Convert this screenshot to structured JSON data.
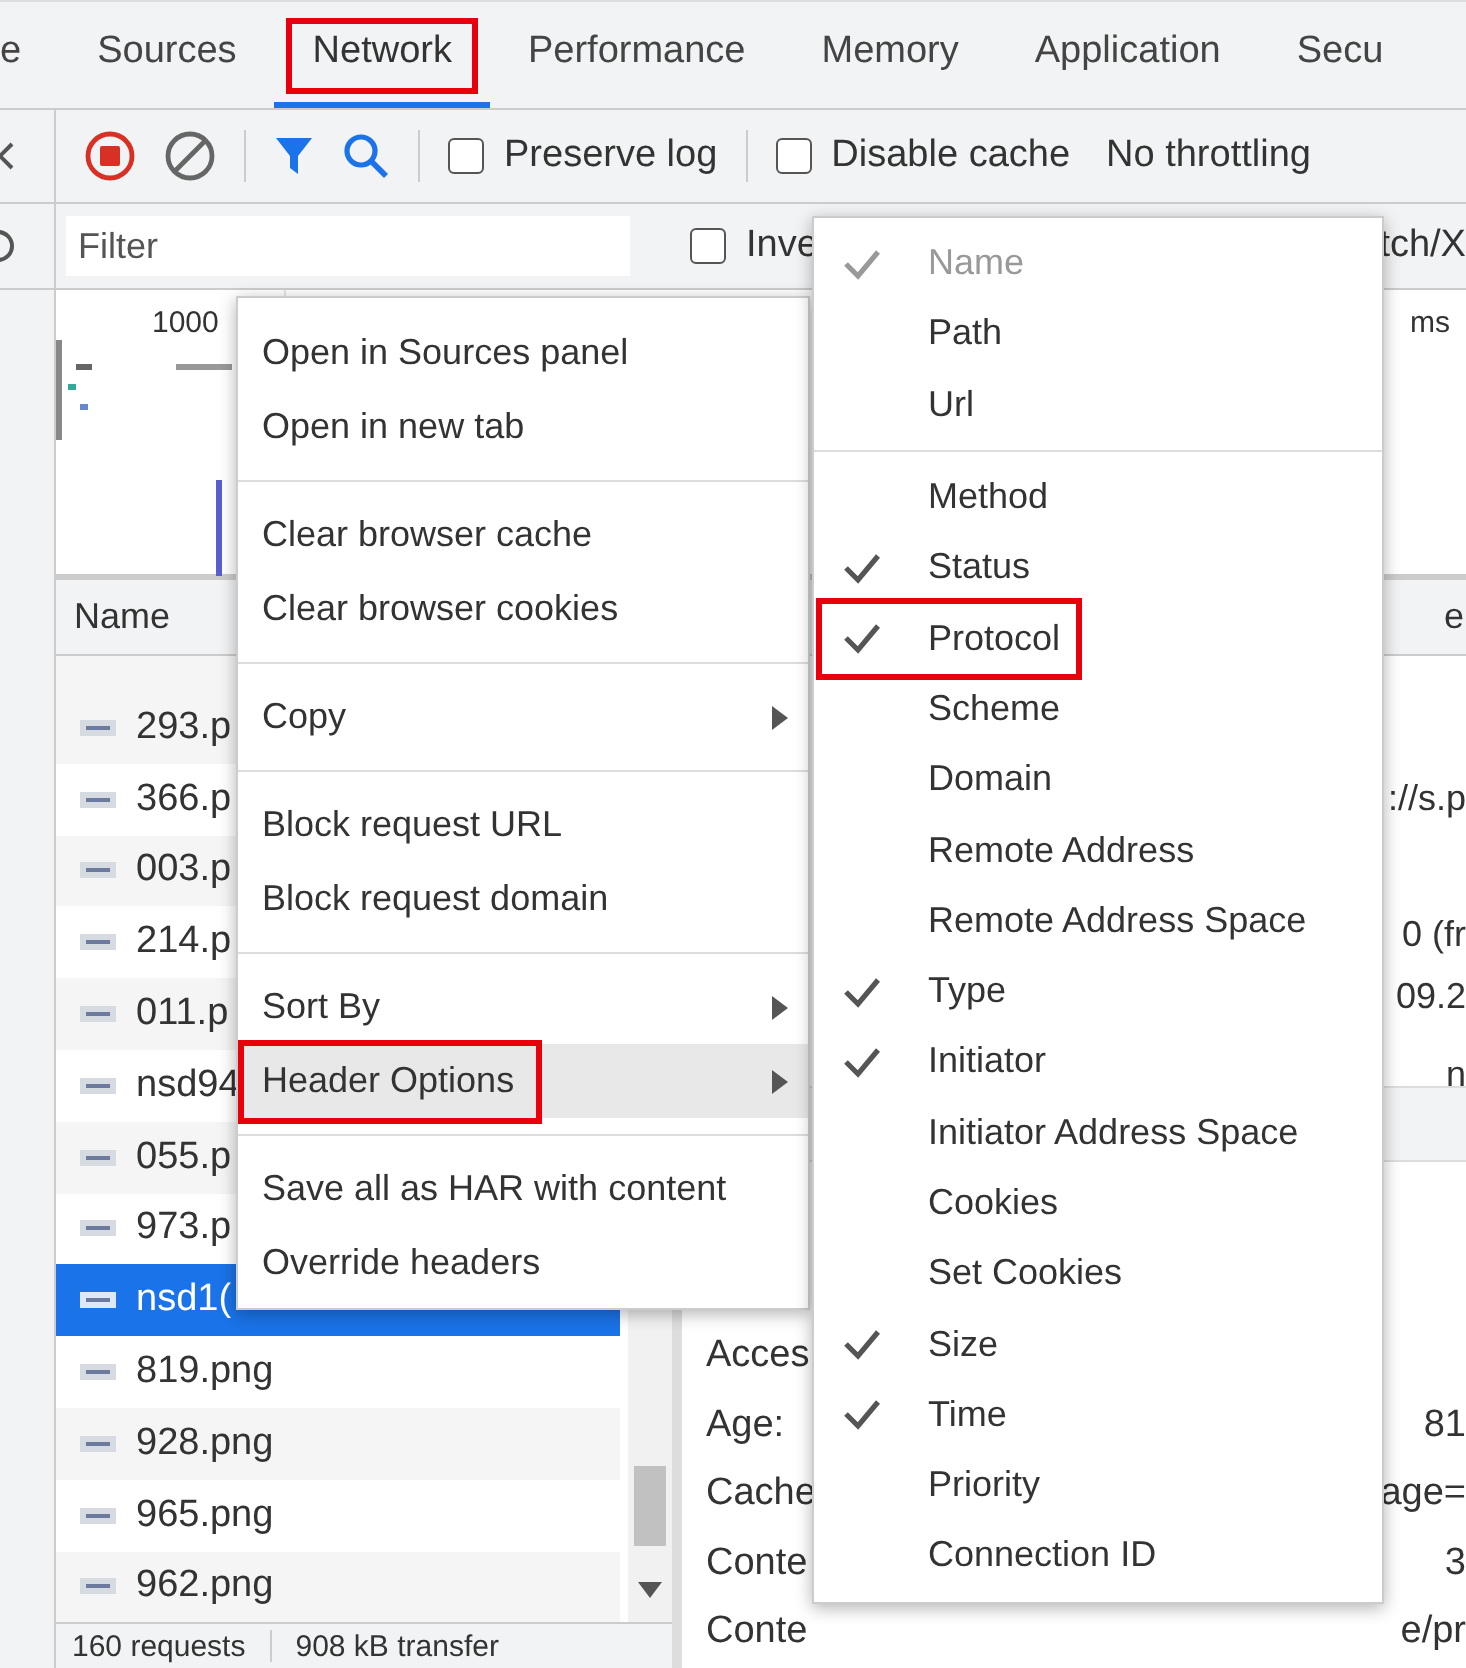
{
  "tabs": [
    {
      "label": "e",
      "selected": false,
      "annotated": false
    },
    {
      "label": "Sources",
      "selected": false,
      "annotated": false
    },
    {
      "label": "Network",
      "selected": true,
      "annotated": true
    },
    {
      "label": "Performance",
      "selected": false,
      "annotated": false
    },
    {
      "label": "Memory",
      "selected": false,
      "annotated": false
    },
    {
      "label": "Application",
      "selected": false,
      "annotated": false
    },
    {
      "label": "Secu",
      "selected": false,
      "annotated": false
    }
  ],
  "toolbar": {
    "recording": true,
    "checkboxes": [
      {
        "label": "Preserve log",
        "checked": false
      },
      {
        "label": "Disable cache",
        "checked": false
      }
    ],
    "throttling": "No throttling"
  },
  "filter_bar": {
    "placeholder": "Filter",
    "checkboxes": [
      {
        "label": "Inve",
        "checked": false
      }
    ],
    "trailing_text": "tch/X"
  },
  "overview": {
    "tick": "1000",
    "unit": "ms"
  },
  "requests": {
    "column": "Name",
    "column_2": "e",
    "rows": [
      {
        "name": "293.p",
        "selected": false
      },
      {
        "name": "366.p",
        "selected": false
      },
      {
        "name": "003.p",
        "selected": false
      },
      {
        "name": "214.p",
        "selected": false
      },
      {
        "name": "011.p",
        "selected": false
      },
      {
        "name": "nsd94",
        "selected": false
      },
      {
        "name": "055.p",
        "selected": false
      },
      {
        "name": "973.p",
        "selected": false
      },
      {
        "name": "nsd1(",
        "selected": true
      },
      {
        "name": "819.png",
        "selected": false
      },
      {
        "name": "928.png",
        "selected": false
      },
      {
        "name": "965.png",
        "selected": false
      },
      {
        "name": "962.png",
        "selected": false
      }
    ]
  },
  "details": {
    "general": [
      "://s.p",
      "0 (fr",
      "09.2",
      "n"
    ],
    "headers": [
      {
        "label": "Acces"
      },
      {
        "label": "Age:",
        "value": "81"
      },
      {
        "label": "Cache",
        "value": "age="
      },
      {
        "label": "Conte",
        "value": "3"
      },
      {
        "label": "Conte",
        "value": "e/pr"
      }
    ]
  },
  "status_bar": [
    "160 requests",
    "908 kB transfer"
  ],
  "context_menu": {
    "groups": [
      [
        {
          "label": "Open in Sources panel",
          "submenu": false,
          "highlighted": false,
          "annotated": false
        },
        {
          "label": "Open in new tab",
          "submenu": false,
          "highlighted": false,
          "annotated": false
        }
      ],
      [
        {
          "label": "Clear browser cache",
          "submenu": false,
          "highlighted": false,
          "annotated": false
        },
        {
          "label": "Clear browser cookies",
          "submenu": false,
          "highlighted": false,
          "annotated": false
        }
      ],
      [
        {
          "label": "Copy",
          "submenu": true,
          "highlighted": false,
          "annotated": false
        }
      ],
      [
        {
          "label": "Block request URL",
          "submenu": false,
          "highlighted": false,
          "annotated": false
        },
        {
          "label": "Block request domain",
          "submenu": false,
          "highlighted": false,
          "annotated": false
        }
      ],
      [
        {
          "label": "Sort By",
          "submenu": true,
          "highlighted": false,
          "annotated": false
        },
        {
          "label": "Header Options",
          "submenu": true,
          "highlighted": true,
          "annotated": true
        }
      ],
      [
        {
          "label": "Save all as HAR with content",
          "submenu": false,
          "highlighted": false,
          "annotated": false
        },
        {
          "label": "Override headers",
          "submenu": false,
          "highlighted": false,
          "annotated": false
        }
      ]
    ]
  },
  "submenu": {
    "groups": [
      [
        {
          "label": "Name",
          "checked": true,
          "disabled": true,
          "annotated": false
        },
        {
          "label": "Path",
          "checked": false,
          "disabled": false,
          "annotated": false
        },
        {
          "label": "Url",
          "checked": false,
          "disabled": false,
          "annotated": false
        }
      ],
      [
        {
          "label": "Method",
          "checked": false,
          "disabled": false,
          "annotated": false
        },
        {
          "label": "Status",
          "checked": true,
          "disabled": false,
          "annotated": false
        },
        {
          "label": "Protocol",
          "checked": true,
          "disabled": false,
          "annotated": true
        },
        {
          "label": "Scheme",
          "checked": false,
          "disabled": false,
          "annotated": false
        },
        {
          "label": "Domain",
          "checked": false,
          "disabled": false,
          "annotated": false
        },
        {
          "label": "Remote Address",
          "checked": false,
          "disabled": false,
          "annotated": false
        },
        {
          "label": "Remote Address Space",
          "checked": false,
          "disabled": false,
          "annotated": false
        },
        {
          "label": "Type",
          "checked": true,
          "disabled": false,
          "annotated": false
        },
        {
          "label": "Initiator",
          "checked": true,
          "disabled": false,
          "annotated": false
        },
        {
          "label": "Initiator Address Space",
          "checked": false,
          "disabled": false,
          "annotated": false
        },
        {
          "label": "Cookies",
          "checked": false,
          "disabled": false,
          "annotated": false
        },
        {
          "label": "Set Cookies",
          "checked": false,
          "disabled": false,
          "annotated": false
        },
        {
          "label": "Size",
          "checked": true,
          "disabled": false,
          "annotated": false
        },
        {
          "label": "Time",
          "checked": true,
          "disabled": false,
          "annotated": false
        },
        {
          "label": "Priority",
          "checked": false,
          "disabled": false,
          "annotated": false
        },
        {
          "label": "Connection ID",
          "checked": false,
          "disabled": false,
          "annotated": false
        }
      ]
    ]
  }
}
